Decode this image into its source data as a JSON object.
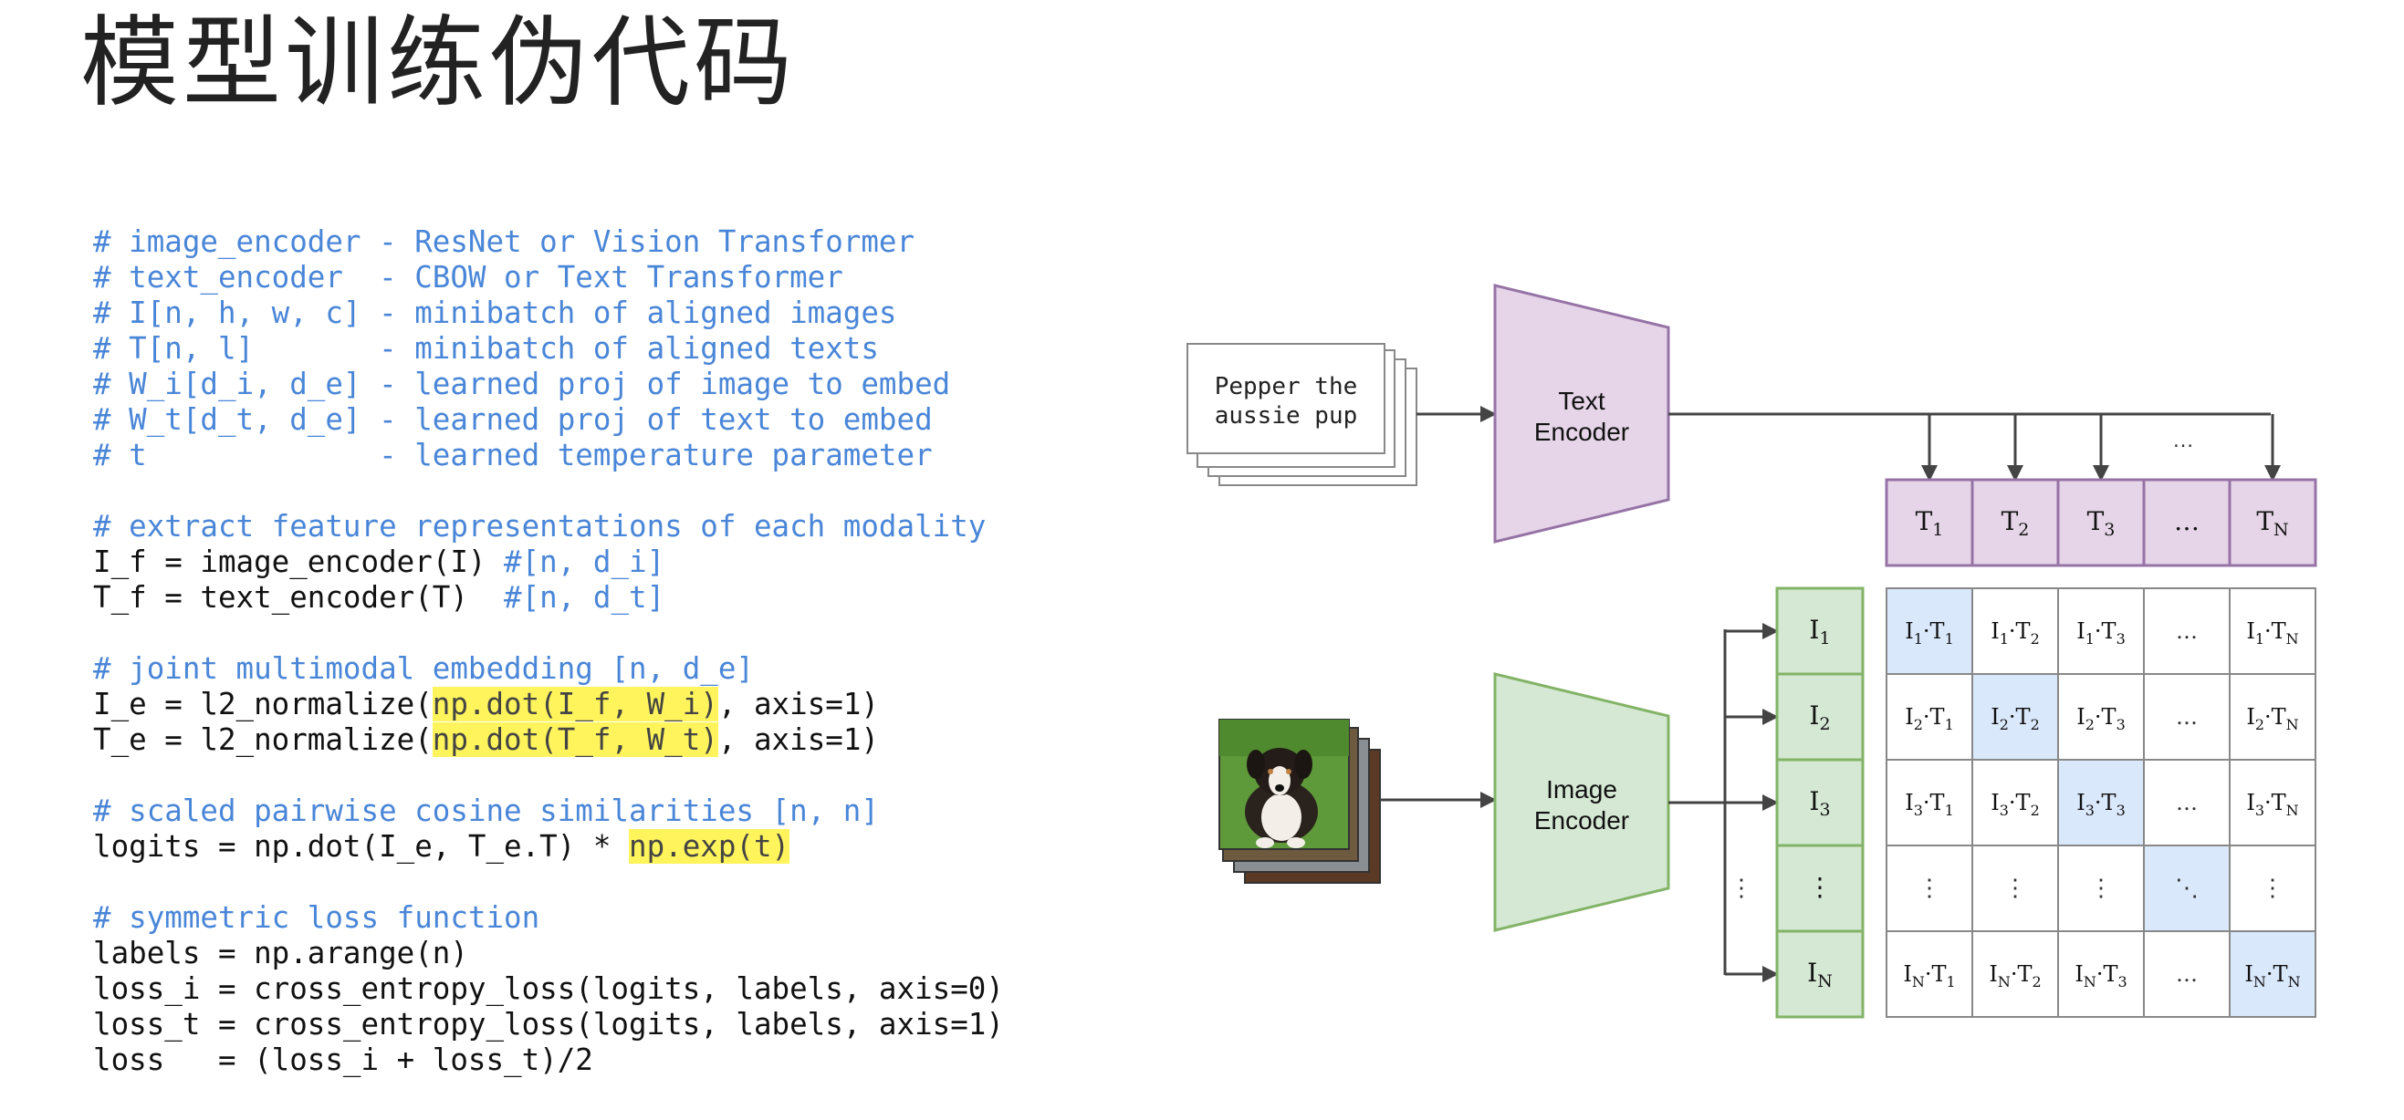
{
  "title": "模型训练伪代码",
  "code_lines": [
    {
      "type": "comment",
      "text": "# image_encoder - ResNet or Vision Transformer"
    },
    {
      "type": "comment",
      "text": "# text_encoder  - CBOW or Text Transformer"
    },
    {
      "type": "comment",
      "text": "# I[n, h, w, c] - minibatch of aligned images"
    },
    {
      "type": "comment",
      "text": "# T[n, l]       - minibatch of aligned texts"
    },
    {
      "type": "comment",
      "text": "# W_i[d_i, d_e] - learned proj of image to embed"
    },
    {
      "type": "comment",
      "text": "# W_t[d_t, d_e] - learned proj of text to embed"
    },
    {
      "type": "comment",
      "text": "# t             - learned temperature parameter"
    },
    {
      "type": "blank",
      "text": ""
    },
    {
      "type": "comment",
      "text": "# extract feature representations of each modality"
    },
    {
      "type": "code",
      "text": "I_f = image_encoder(I) ",
      "comment": "#[n, d_i]"
    },
    {
      "type": "code",
      "text": "T_f = text_encoder(T)  ",
      "comment": "#[n, d_t]"
    },
    {
      "type": "blank",
      "text": ""
    },
    {
      "type": "comment",
      "text": "# joint multimodal embedding [n, d_e]"
    },
    {
      "type": "code",
      "pre": "I_e = l2_normalize(",
      "hl": "np.dot(I_f, W_i)",
      "post": ", axis=1)"
    },
    {
      "type": "code",
      "pre": "T_e = l2_normalize(",
      "hl": "np.dot(T_f, W_t)",
      "post": ", axis=1)"
    },
    {
      "type": "blank",
      "text": ""
    },
    {
      "type": "comment",
      "text": "# scaled pairwise cosine similarities [n, n]"
    },
    {
      "type": "code",
      "pre": "logits = np.dot(I_e, T_e.T) * ",
      "hl": "np.exp(t)",
      "post": ""
    },
    {
      "type": "blank",
      "text": ""
    },
    {
      "type": "comment",
      "text": "# symmetric loss function"
    },
    {
      "type": "code",
      "text": "labels = np.arange(n)"
    },
    {
      "type": "code",
      "text": "loss_i = cross_entropy_loss(logits, labels, axis=0)"
    },
    {
      "type": "code",
      "text": "loss_t = cross_entropy_loss(logits, labels, axis=1)"
    },
    {
      "type": "code",
      "text": "loss   = (loss_i + loss_t)/2"
    }
  ],
  "diagram": {
    "text_input": [
      "Pepper the",
      "aussie pup"
    ],
    "text_encoder": [
      "Text",
      "Encoder"
    ],
    "image_encoder": [
      "Image",
      "Encoder"
    ],
    "image_input_icon": "puppy-photo-stack",
    "text_cells": [
      {
        "base": "T",
        "sub": "1"
      },
      {
        "base": "T",
        "sub": "2"
      },
      {
        "base": "T",
        "sub": "3"
      },
      {
        "base": "…",
        "sub": ""
      },
      {
        "base": "T",
        "sub": "N"
      }
    ],
    "image_cells": [
      {
        "base": "I",
        "sub": "1"
      },
      {
        "base": "I",
        "sub": "2"
      },
      {
        "base": "I",
        "sub": "3"
      },
      {
        "base": "⋮",
        "sub": ""
      },
      {
        "base": "I",
        "sub": "N"
      }
    ],
    "arrow_ellipsis": "…",
    "vertical_ellipsis": "⋮",
    "diagonal_ellipsis": "⋱",
    "colors": {
      "text_encoder_fill": "#e6d5e8",
      "text_encoder_stroke": "#9673a6",
      "image_encoder_fill": "#d5e8d4",
      "image_encoder_stroke": "#82b366",
      "diag_fill": "#dae8fc",
      "comment": "#4a86d8",
      "highlight": "#fff45c"
    }
  }
}
